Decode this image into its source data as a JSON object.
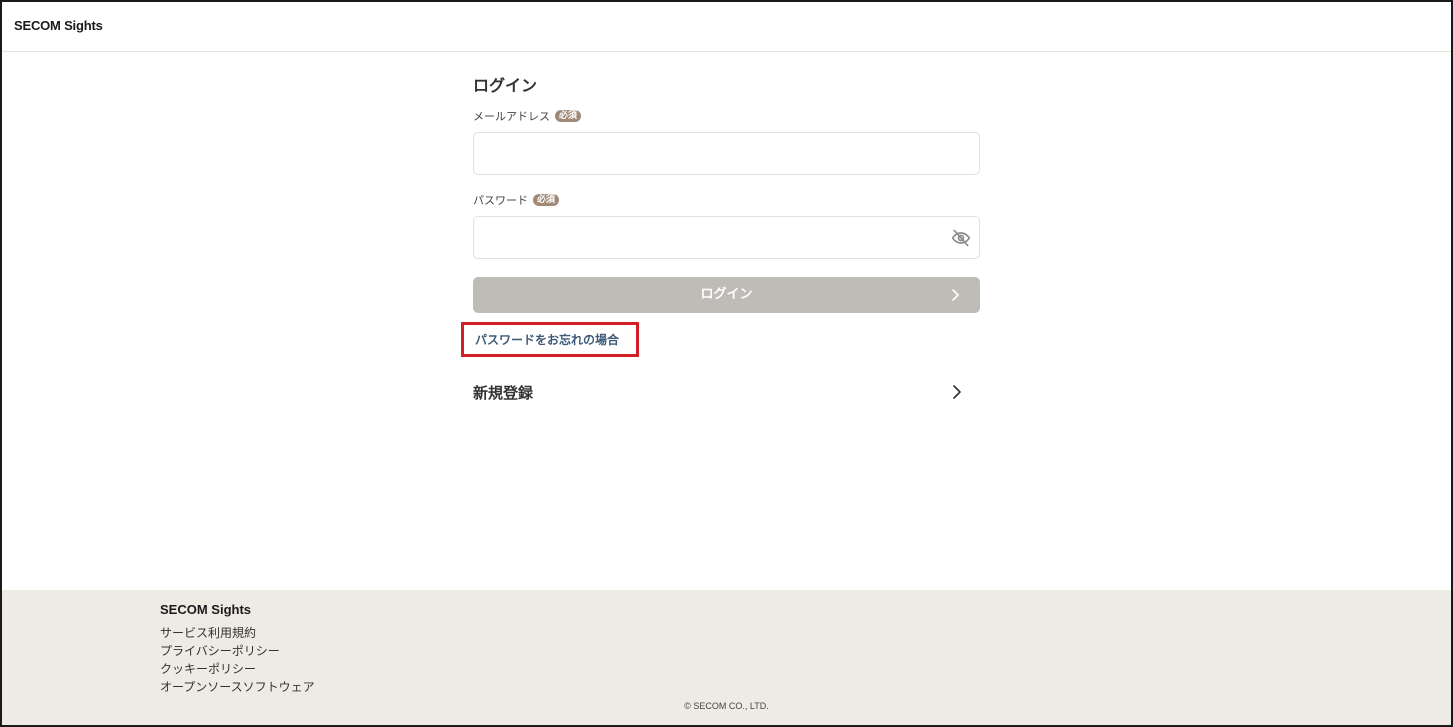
{
  "header": {
    "logo": "SECOM Sights"
  },
  "login": {
    "title": "ログイン",
    "email": {
      "label": "メールアドレス",
      "required_badge": "必須",
      "value": "",
      "placeholder": ""
    },
    "password": {
      "label": "パスワード",
      "required_badge": "必須",
      "value": "",
      "placeholder": "",
      "toggle_icon": "eye-off-icon"
    },
    "submit_label": "ログイン",
    "forgot_label": "パスワードをお忘れの場合",
    "register_label": "新規登録"
  },
  "footer": {
    "logo": "SECOM Sights",
    "links": [
      "サービス利用規約",
      "プライバシーポリシー",
      "クッキーポリシー",
      "オープンソースソフトウェア"
    ],
    "copyright": "© SECOM CO., LTD."
  },
  "colors": {
    "accent_badge": "#a08a76",
    "button_disabled": "#bfbbb7",
    "link": "#3d5a78",
    "highlight_border": "#d21f27",
    "footer_bg": "#eeebe4"
  }
}
